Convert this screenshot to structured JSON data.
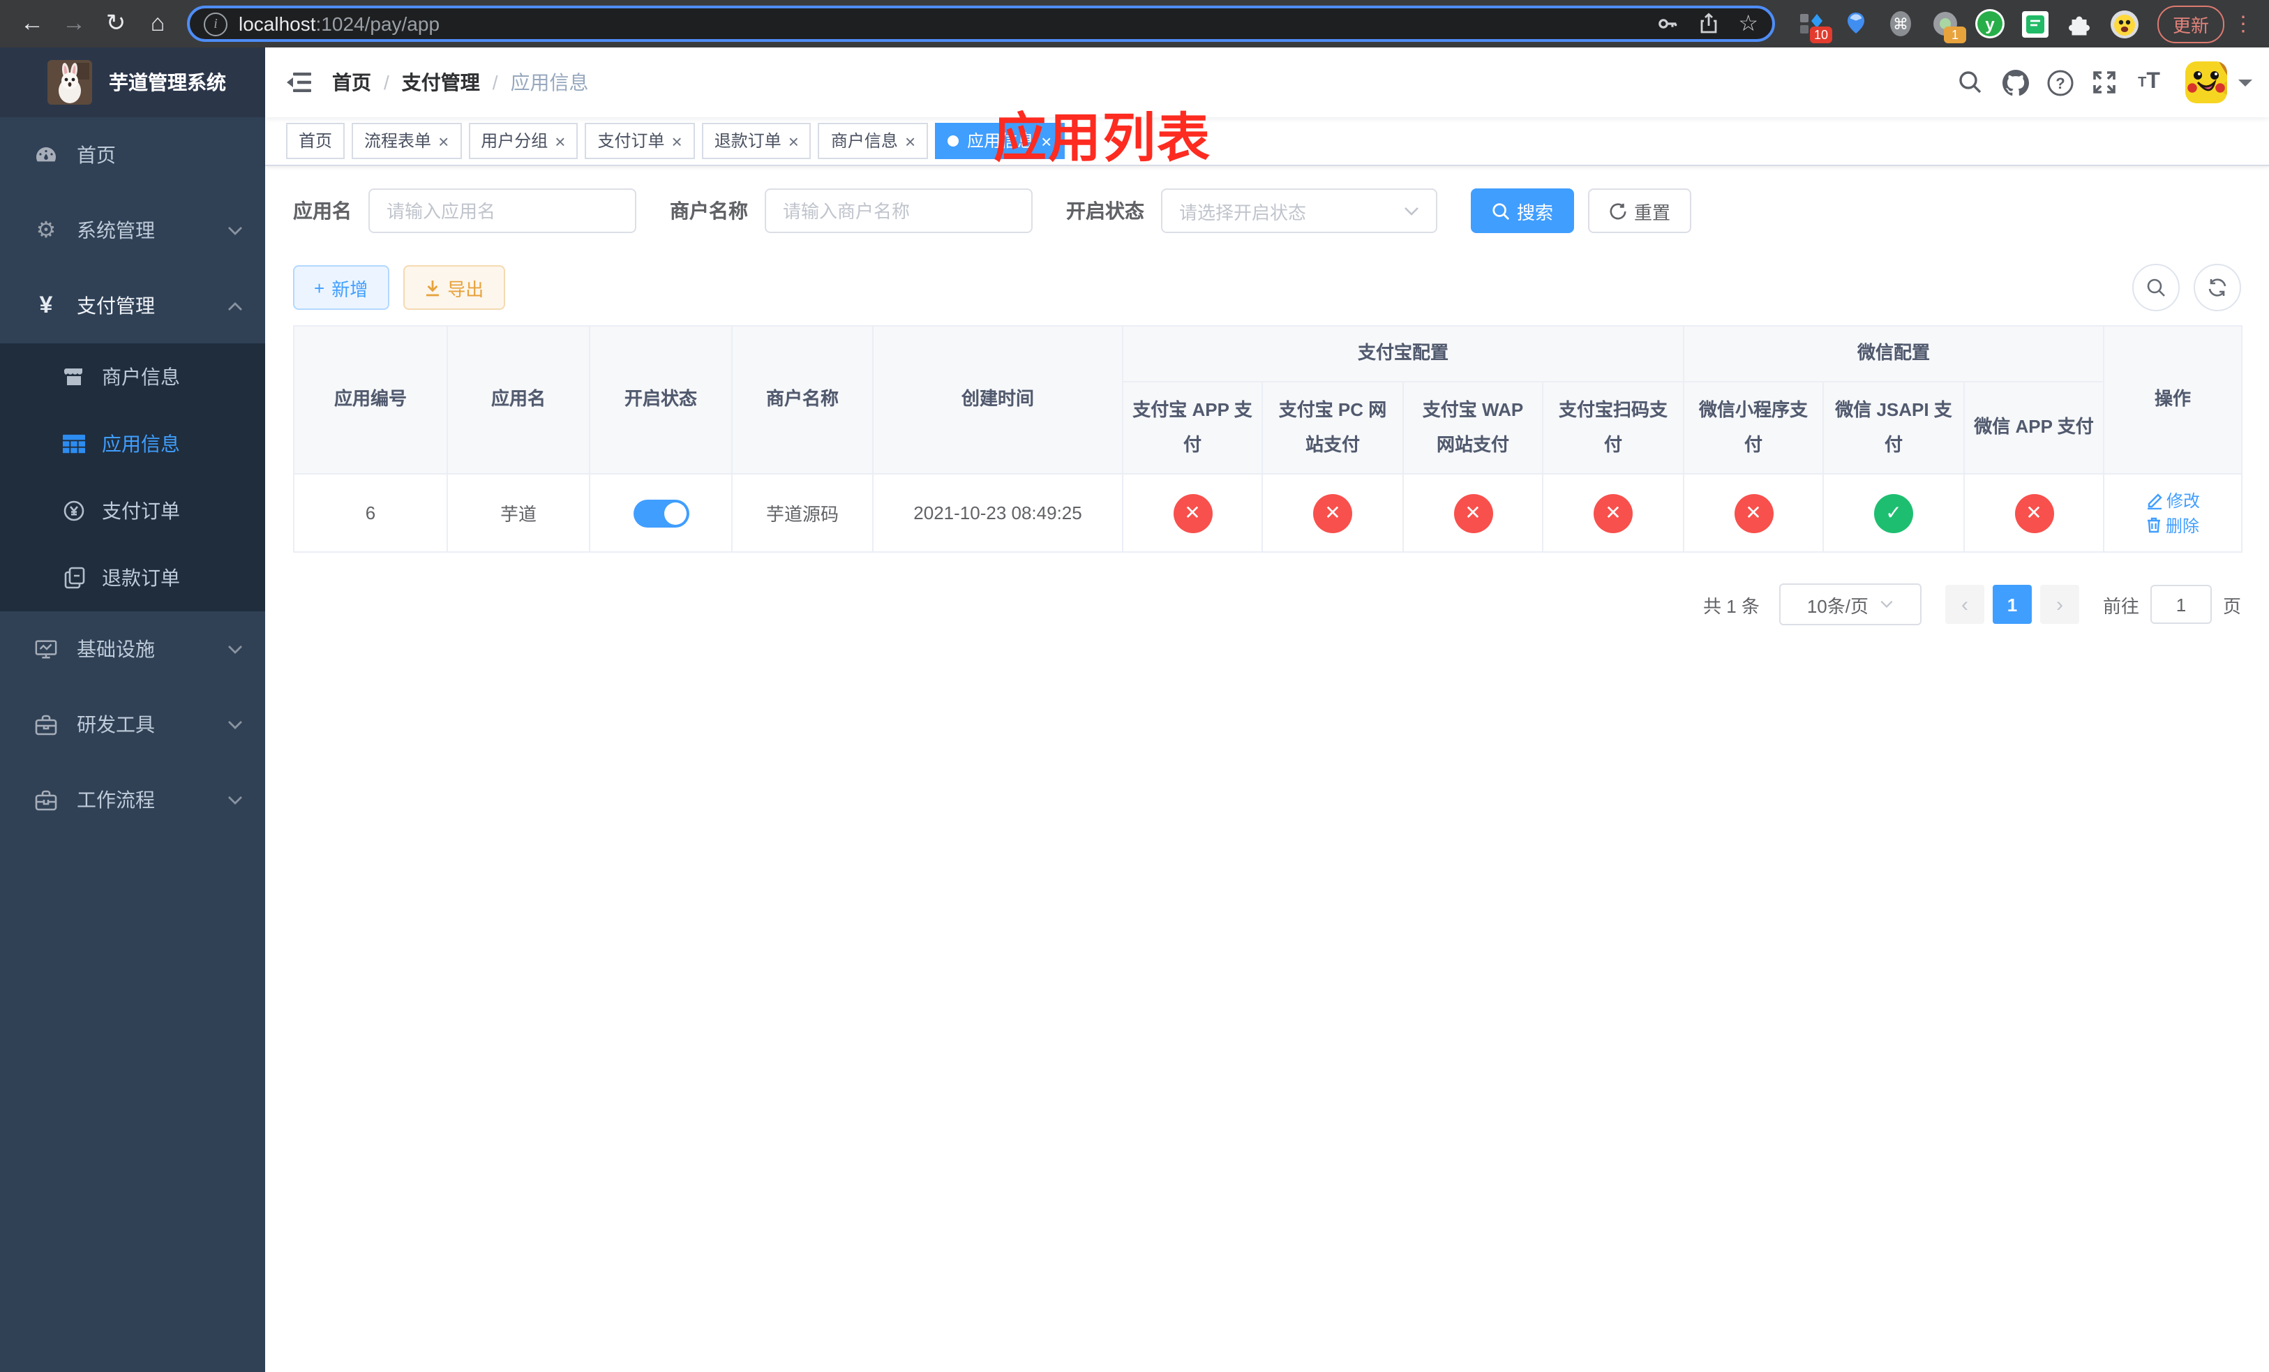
{
  "browser": {
    "url": {
      "host": "localhost",
      "path": ":1024/pay/app"
    },
    "extensions": {
      "badge_a": "10",
      "badge_b": "1",
      "letter": "y"
    },
    "update_label": "更新"
  },
  "sidebar": {
    "logo_title": "芋道管理系统",
    "items": [
      {
        "label": "首页"
      },
      {
        "label": "系统管理"
      },
      {
        "label": "支付管理"
      },
      {
        "label": "基础设施"
      },
      {
        "label": "研发工具"
      },
      {
        "label": "工作流程"
      }
    ],
    "sub_items": [
      {
        "label": "商户信息"
      },
      {
        "label": "应用信息"
      },
      {
        "label": "支付订单"
      },
      {
        "label": "退款订单"
      }
    ]
  },
  "header": {
    "breadcrumbs": [
      "首页",
      "支付管理",
      "应用信息"
    ],
    "annotation": "应用列表"
  },
  "tabs": [
    {
      "label": "首页"
    },
    {
      "label": "流程表单"
    },
    {
      "label": "用户分组"
    },
    {
      "label": "支付订单"
    },
    {
      "label": "退款订单"
    },
    {
      "label": "商户信息"
    },
    {
      "label": "应用信息"
    }
  ],
  "filters": {
    "app_name_label": "应用名",
    "app_name_placeholder": "请输入应用名",
    "merchant_label": "商户名称",
    "merchant_placeholder": "请输入商户名称",
    "status_label": "开启状态",
    "status_placeholder": "请选择开启状态",
    "search_label": "搜索",
    "reset_label": "重置"
  },
  "toolbar": {
    "add_label": "新增",
    "export_label": "导出"
  },
  "table": {
    "groups": {
      "alipay": "支付宝配置",
      "wechat": "微信配置"
    },
    "columns": {
      "id": "应用编号",
      "name": "应用名",
      "status": "开启状态",
      "merchant": "商户名称",
      "created": "创建时间",
      "alipay_app": "支付宝 APP 支付",
      "alipay_pc": "支付宝 PC 网站支付",
      "alipay_wap": "支付宝 WAP 网站支付",
      "alipay_qr": "支付宝扫码支付",
      "wx_mini": "微信小程序支付",
      "wx_jsapi": "微信 JSAPI 支付",
      "wx_app": "微信 APP 支付",
      "ops": "操作"
    },
    "rows": [
      {
        "id": "6",
        "name": "芋道",
        "merchant": "芋道源码",
        "created": "2021-10-23 08:49:25",
        "channels": [
          "closed",
          "closed",
          "closed",
          "closed",
          "closed",
          "open",
          "closed"
        ],
        "edit_label": "修改",
        "delete_label": "删除"
      }
    ]
  },
  "pagination": {
    "total": "共 1 条",
    "page_size": "10条/页",
    "page": "1",
    "goto_label": "前往",
    "goto_value": "1",
    "unit": "页"
  },
  "colors": {
    "primary": "#409eff",
    "sidebar_bg": "#304156",
    "submenu_bg": "#1f2d3d",
    "status_closed": "#f8504c",
    "status_open": "#1ebe70",
    "annotation_red": "#fd2b20"
  }
}
